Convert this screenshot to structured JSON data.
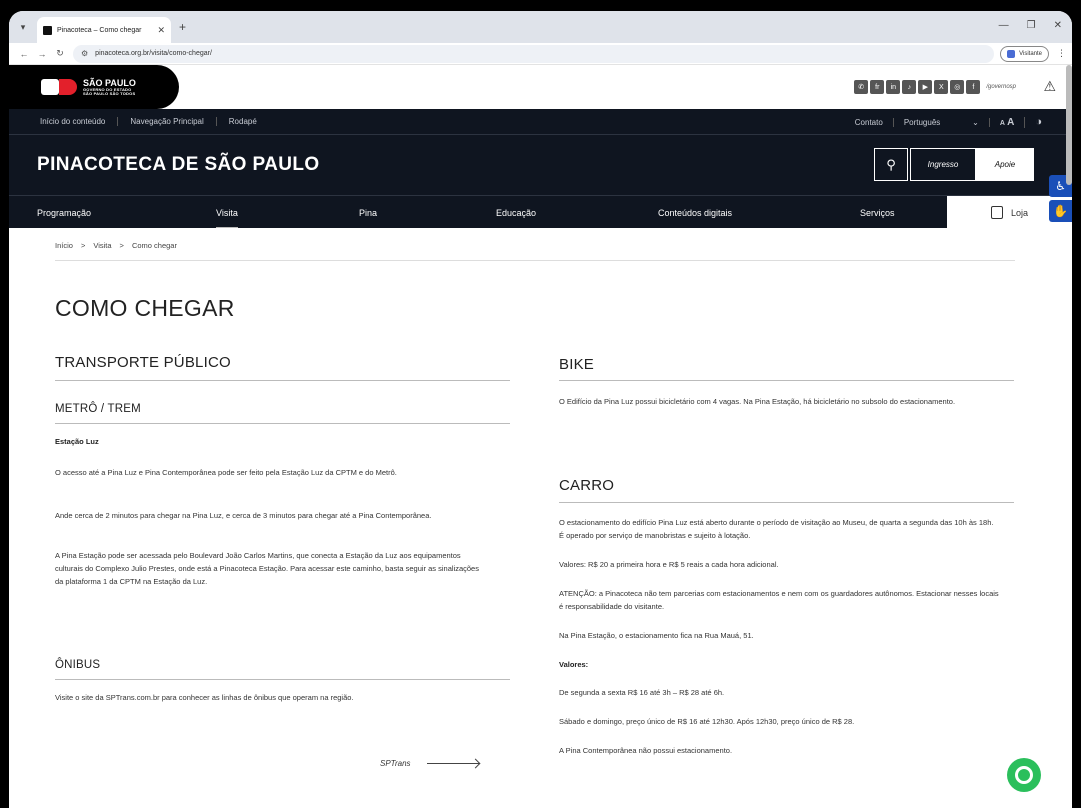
{
  "browser": {
    "tab_title": "Pinacoteca – Como chegar",
    "url": "pinacoteca.org.br/visita/como-chegar/",
    "profile_label": "Visitante"
  },
  "govbar": {
    "logo_line1": "SÃO PAULO",
    "logo_line2": "GOVERNO DO ESTADO",
    "logo_line3": "SÃO PAULO SÃO TODOS",
    "social_handle": "/governosp"
  },
  "utilbar": {
    "links": [
      "Início do conteúdo",
      "Navegação Principal",
      "Rodapé"
    ],
    "contato": "Contato",
    "language": "Português",
    "font_small": "A",
    "font_big": "A"
  },
  "header": {
    "site_title": "PINACOTECA DE SÃO PAULO",
    "ingresso": "Ingresso",
    "apoie": "Apoie"
  },
  "mainnav": {
    "items": [
      "Programação",
      "Visita",
      "Pina",
      "Educação",
      "Conteúdos digitais",
      "Serviços"
    ],
    "active": "Visita",
    "loja": "Loja"
  },
  "breadcrumb": {
    "items": [
      "Início",
      "Visita",
      "Como chegar"
    ],
    "sep": ">"
  },
  "page": {
    "title": "COMO CHEGAR",
    "transporte": {
      "heading": "TRANSPORTE PÚBLICO",
      "metro_heading": "METRÔ / TREM",
      "estacao": "Estação Luz",
      "p1": "O acesso até a Pina Luz e Pina Contemporânea pode ser feito pela Estação Luz da CPTM e do Metrô.",
      "p2": "Ande cerca de 2 minutos para chegar na Pina Luz, e cerca de 3 minutos para chegar até a Pina Contemporânea.",
      "p3": "A Pina Estação pode ser acessada pelo Boulevard João Carlos Martins, que conecta a Estação da Luz aos equipamentos culturais do Complexo Julio Prestes, onde está a Pinacoteca Estação. Para acessar este caminho, basta seguir as sinalizações da plataforma 1 da CPTM na Estação da Luz.",
      "onibus_heading": "ÔNIBUS",
      "onibus_text": "Visite o site da SPTrans.com.br para conhecer as linhas de ônibus que operam na região.",
      "sptrans_link": "SPTrans"
    },
    "bike": {
      "heading": "BIKE",
      "text": "O Edifício da Pina Luz possui bicicletário com 4 vagas. Na Pina Estação, há bicicletário no subsolo do estacionamento."
    },
    "carro": {
      "heading": "CARRO",
      "p1": "O estacionamento do edifício Pina Luz está aberto durante o período de visitação ao Museu, de quarta a segunda das 10h às 18h. É operado por serviço de manobristas e sujeito à lotação.",
      "p2": "Valores: R$ 20 a primeira hora e R$ 5 reais a cada hora adicional.",
      "p3": "ATENÇÃO: a Pinacoteca não tem parcerias com estacionamentos e nem com os guardadores autônomos. Estacionar nesses locais é responsabilidade do visitante.",
      "p4": "Na Pina Estação, o estacionamento fica na Rua Mauá, 51.",
      "valores_label": "Valores:",
      "p5": "De segunda a sexta R$ 16 até 3h – R$ 28 até 6h.",
      "p6": "Sábado e domingo, preço único de R$ 16 até 12h30. Após 12h30, preço único de R$ 28.",
      "p7": "A Pina Contemporânea não possui estacionamento."
    }
  },
  "colors": {
    "header_bg": "#0f1520",
    "chat_button": "#2bbf5c",
    "a11y_blue": "#1a4fb8"
  }
}
